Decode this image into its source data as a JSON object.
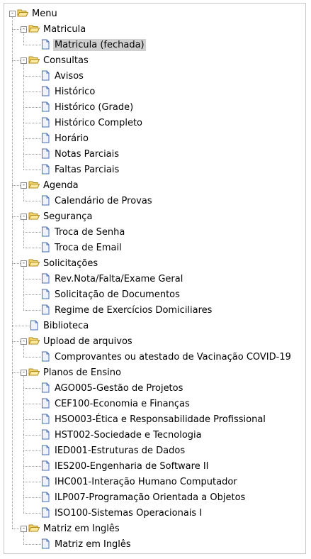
{
  "tree": {
    "root_label": "Menu",
    "nodes": [
      {
        "label": "Menu",
        "type": "folder",
        "depth": 0,
        "expanded": true
      },
      {
        "label": "Matricula",
        "type": "folder",
        "depth": 1,
        "expanded": true
      },
      {
        "label": "Matricula (fechada)",
        "type": "page",
        "depth": 2,
        "selected": true
      },
      {
        "label": "Consultas",
        "type": "folder",
        "depth": 1,
        "expanded": true
      },
      {
        "label": "Avisos",
        "type": "page",
        "depth": 2
      },
      {
        "label": "Histórico",
        "type": "page",
        "depth": 2
      },
      {
        "label": "Histórico (Grade)",
        "type": "page",
        "depth": 2
      },
      {
        "label": "Histórico Completo",
        "type": "page",
        "depth": 2
      },
      {
        "label": "Horário",
        "type": "page",
        "depth": 2
      },
      {
        "label": "Notas Parciais",
        "type": "page",
        "depth": 2
      },
      {
        "label": "Faltas Parciais",
        "type": "page",
        "depth": 2
      },
      {
        "label": "Agenda",
        "type": "folder",
        "depth": 1,
        "expanded": true
      },
      {
        "label": "Calendário de Provas",
        "type": "page",
        "depth": 2
      },
      {
        "label": "Segurança",
        "type": "folder",
        "depth": 1,
        "expanded": true
      },
      {
        "label": "Troca de Senha",
        "type": "page",
        "depth": 2
      },
      {
        "label": "Troca de Email",
        "type": "page",
        "depth": 2
      },
      {
        "label": "Solicitações",
        "type": "folder",
        "depth": 1,
        "expanded": true
      },
      {
        "label": "Rev.Nota/Falta/Exame Geral",
        "type": "page",
        "depth": 2
      },
      {
        "label": "Solicitação de Documentos",
        "type": "page",
        "depth": 2
      },
      {
        "label": "Regime de Exercícios Domiciliares",
        "type": "page",
        "depth": 2
      },
      {
        "label": "Biblioteca",
        "type": "page",
        "depth": 1
      },
      {
        "label": "Upload de arquivos",
        "type": "folder",
        "depth": 1,
        "expanded": true
      },
      {
        "label": "Comprovantes ou atestado de Vacinação COVID-19",
        "type": "page",
        "depth": 2
      },
      {
        "label": "Planos de Ensino",
        "type": "folder",
        "depth": 1,
        "expanded": true
      },
      {
        "label": "AGO005-Gestão de Projetos",
        "type": "page",
        "depth": 2
      },
      {
        "label": "CEF100-Economia e Finanças",
        "type": "page",
        "depth": 2
      },
      {
        "label": "HSO003-Ética e Responsabilidade Profissional",
        "type": "page",
        "depth": 2
      },
      {
        "label": "HST002-Sociedade e Tecnologia",
        "type": "page",
        "depth": 2
      },
      {
        "label": "IED001-Estruturas de Dados",
        "type": "page",
        "depth": 2
      },
      {
        "label": "IES200-Engenharia de Software II",
        "type": "page",
        "depth": 2
      },
      {
        "label": "IHC001-Interação Humano Computador",
        "type": "page",
        "depth": 2
      },
      {
        "label": "ILP007-Programação Orientada a Objetos",
        "type": "page",
        "depth": 2
      },
      {
        "label": "ISO100-Sistemas Operacionais I",
        "type": "page",
        "depth": 2
      },
      {
        "label": "Matriz em Inglês",
        "type": "folder",
        "depth": 1,
        "expanded": true
      },
      {
        "label": "Matriz em Inglês",
        "type": "page",
        "depth": 2
      }
    ]
  },
  "colors": {
    "folder_fill": "#f5d66a",
    "folder_stroke": "#b08a1e",
    "page_fill": "#eef4ff",
    "page_stroke": "#4a6fb5",
    "selected_bg": "#cfcfcf",
    "connector": "#9a9a9a"
  },
  "icons": {
    "folder": "folder-open-icon",
    "page": "page-icon",
    "expander": "collapse-icon"
  }
}
